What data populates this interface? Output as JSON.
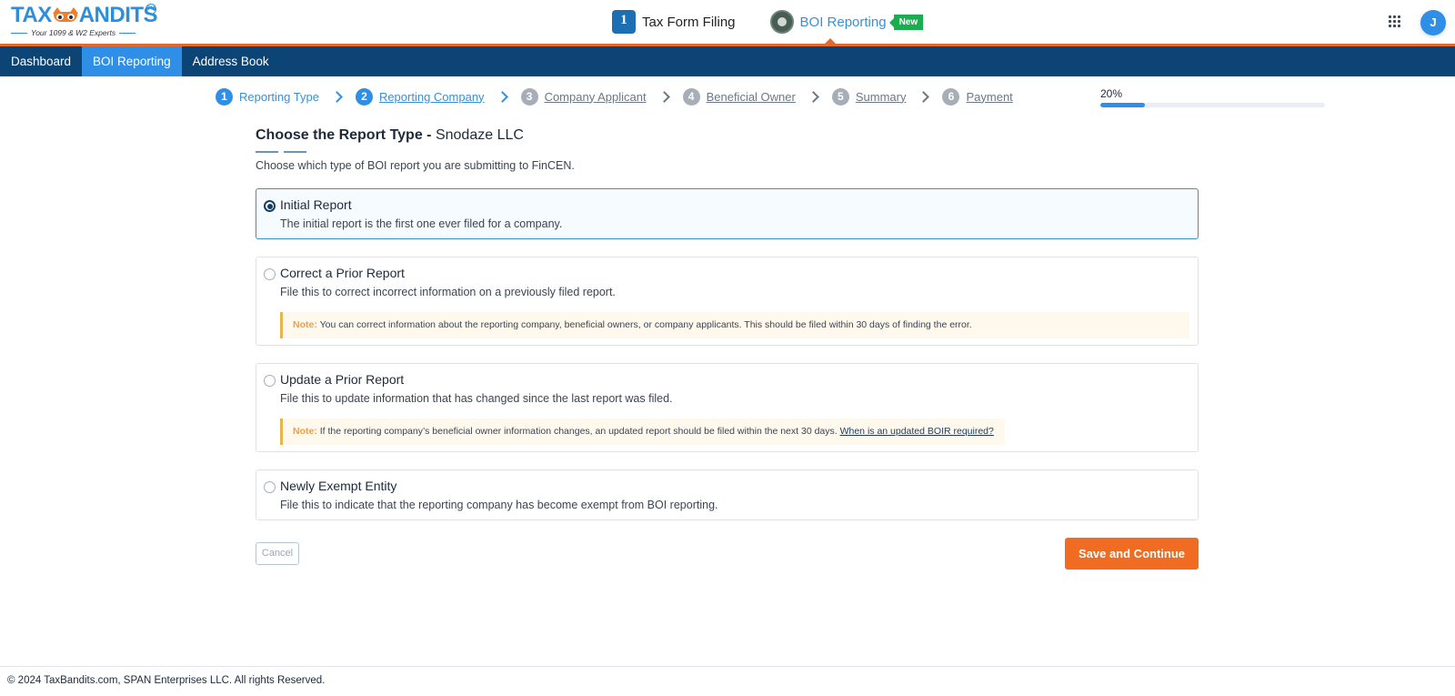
{
  "header": {
    "logo": {
      "brand_left": "TAX",
      "brand_right": "ANDITS",
      "trademark": "TM",
      "tagline": "Your 1099 & W2 Experts"
    },
    "apps": [
      {
        "label": "Tax Form Filing",
        "icon": "irs-icon",
        "active": false
      },
      {
        "label": "BOI Reporting",
        "icon": "boi-seal-icon",
        "active": true,
        "badge": "New"
      }
    ],
    "avatar_initial": "J",
    "colors": {
      "brand_blue": "#2d8fdc",
      "accent_orange": "#e36a2c",
      "new_badge": "#1aad50"
    }
  },
  "nav": {
    "tabs": [
      {
        "label": "Dashboard",
        "active": false
      },
      {
        "label": "BOI Reporting",
        "active": true
      },
      {
        "label": "Address Book",
        "active": false
      }
    ],
    "bg_color": "#0d4476",
    "active_color": "#2f8fe6"
  },
  "stepper": {
    "steps": [
      {
        "num": "1",
        "label": "Reporting Type",
        "state": "done"
      },
      {
        "num": "2",
        "label": "Reporting Company",
        "state": "current"
      },
      {
        "num": "3",
        "label": "Company Applicant",
        "state": "todo"
      },
      {
        "num": "4",
        "label": "Beneficial Owner",
        "state": "todo"
      },
      {
        "num": "5",
        "label": "Summary",
        "state": "todo"
      },
      {
        "num": "6",
        "label": "Payment",
        "state": "todo"
      }
    ],
    "progress_label": "20%",
    "progress_value": 0.2
  },
  "main": {
    "title": "Choose the Report Type -",
    "company": "Snodaze LLC",
    "subtitle": "Choose which type of BOI report you are submitting to FinCEN.",
    "options": [
      {
        "title": "Initial Report",
        "desc": "The initial report is the first one ever filed for a company.",
        "selected": true
      },
      {
        "title": "Correct a Prior Report",
        "desc": "File this to correct incorrect information on a previously filed report.",
        "selected": false,
        "note_label": "Note:",
        "note_text": " You can correct information about the reporting company, beneficial owners, or company applicants. This should be filed within 30 days of finding the error."
      },
      {
        "title": "Update a Prior Report",
        "desc": "File this to update information that has changed since the last report was filed.",
        "selected": false,
        "note_label": "Note:",
        "note_text": " If the reporting company’s beneficial owner information changes, an updated report should be filed within the next 30 days. ",
        "note_link": "When is an updated BOIR required?"
      },
      {
        "title": "Newly Exempt Entity",
        "desc": "File this to indicate that the reporting company has become exempt from BOI reporting.",
        "selected": false
      }
    ],
    "cancel_label": "Cancel",
    "save_label": "Save and Continue"
  },
  "footer": {
    "text": "© 2024 TaxBandits.com, SPAN Enterprises LLC. All rights Reserved."
  }
}
